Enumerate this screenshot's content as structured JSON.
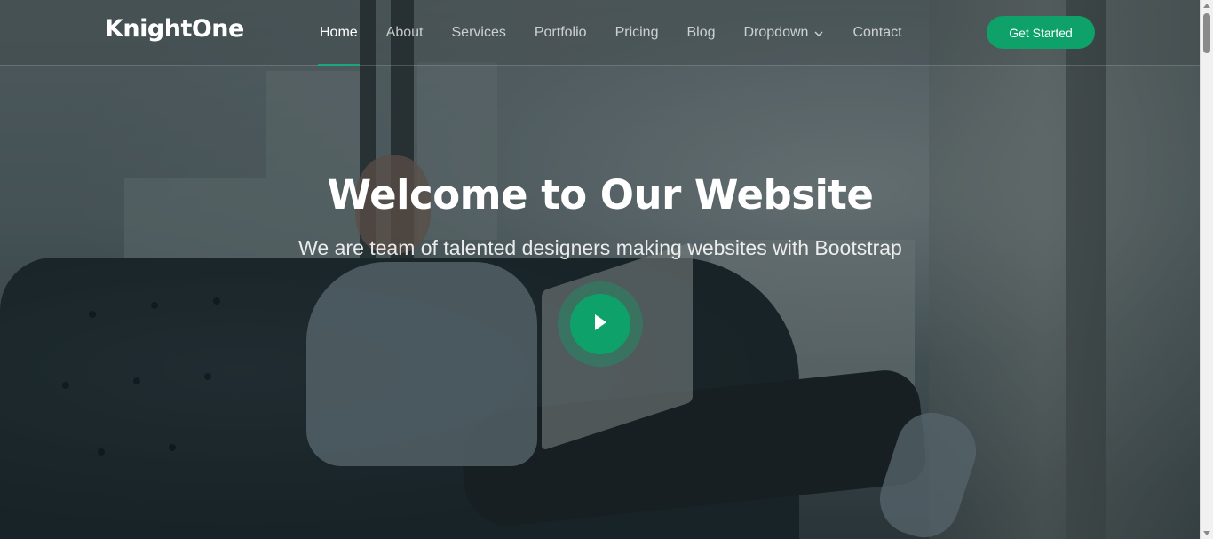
{
  "brand": {
    "name": "KnightOne"
  },
  "nav": {
    "items": [
      {
        "label": "Home",
        "active": true
      },
      {
        "label": "About",
        "active": false
      },
      {
        "label": "Services",
        "active": false
      },
      {
        "label": "Portfolio",
        "active": false
      },
      {
        "label": "Pricing",
        "active": false
      },
      {
        "label": "Blog",
        "active": false
      },
      {
        "label": "Dropdown",
        "active": false,
        "icon": "chevron-down-icon"
      },
      {
        "label": "Contact",
        "active": false
      }
    ],
    "cta_label": "Get Started"
  },
  "hero": {
    "title": "Welcome to Our Website",
    "subtitle": "We are team of talented designers making websites with Bootstrap",
    "play_icon": "play-icon"
  },
  "colors": {
    "accent": "#0ea26a",
    "active_underline": "#1aa77b",
    "text": "#ffffff"
  }
}
